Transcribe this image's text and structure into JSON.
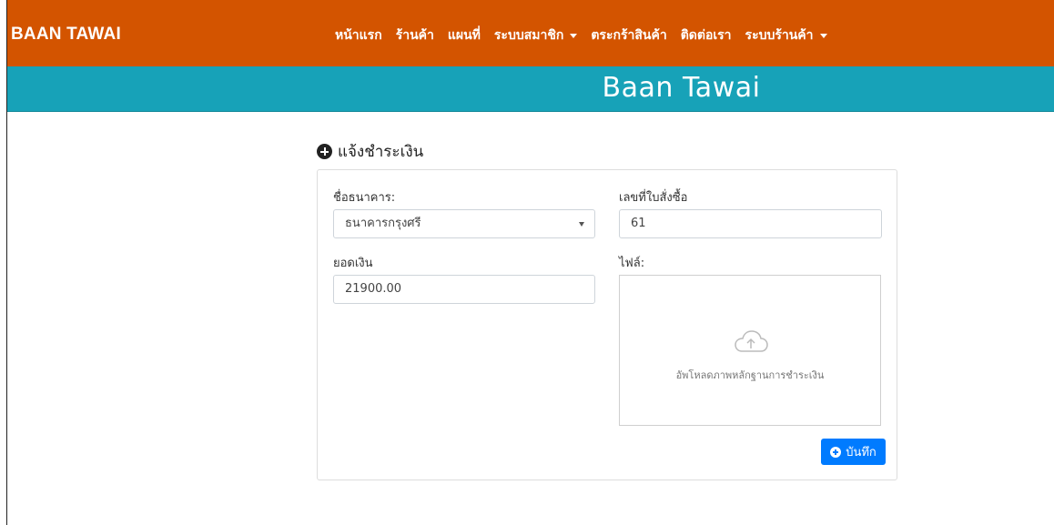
{
  "navbar": {
    "brand": "BAAN TAWAI",
    "items": [
      {
        "label": "หน้าแรก",
        "dropdown": false
      },
      {
        "label": "ร้านค้า",
        "dropdown": false
      },
      {
        "label": "แผนที่",
        "dropdown": false
      },
      {
        "label": "ระบบสมาชิก",
        "dropdown": true
      },
      {
        "label": "ตระกร้าสินค้า",
        "dropdown": false
      },
      {
        "label": "ติดต่อเรา",
        "dropdown": false
      },
      {
        "label": "ระบบร้านค้า",
        "dropdown": true
      }
    ],
    "color": "#d35400"
  },
  "banner": {
    "title": "Baan Tawai",
    "color": "#17a2b8"
  },
  "form": {
    "title": "แจ้งชำระเงิน",
    "title_icon": "plus-circle-icon",
    "bank_label": "ชื่อธนาคาร:",
    "bank_value": "ธนาคารกรุงศรี",
    "order_label": "เลขที่ใบสั่งซื้อ",
    "order_value": "61",
    "amount_label": "ยอดเงิน",
    "amount_value": "21900.00",
    "file_label": "ไฟล์:",
    "upload_icon": "cloud-upload-icon",
    "upload_text": "อัพโหลดภาพหลักฐานการชำระเงิน",
    "save_label": "บันทึก",
    "save_color": "#007bff"
  }
}
